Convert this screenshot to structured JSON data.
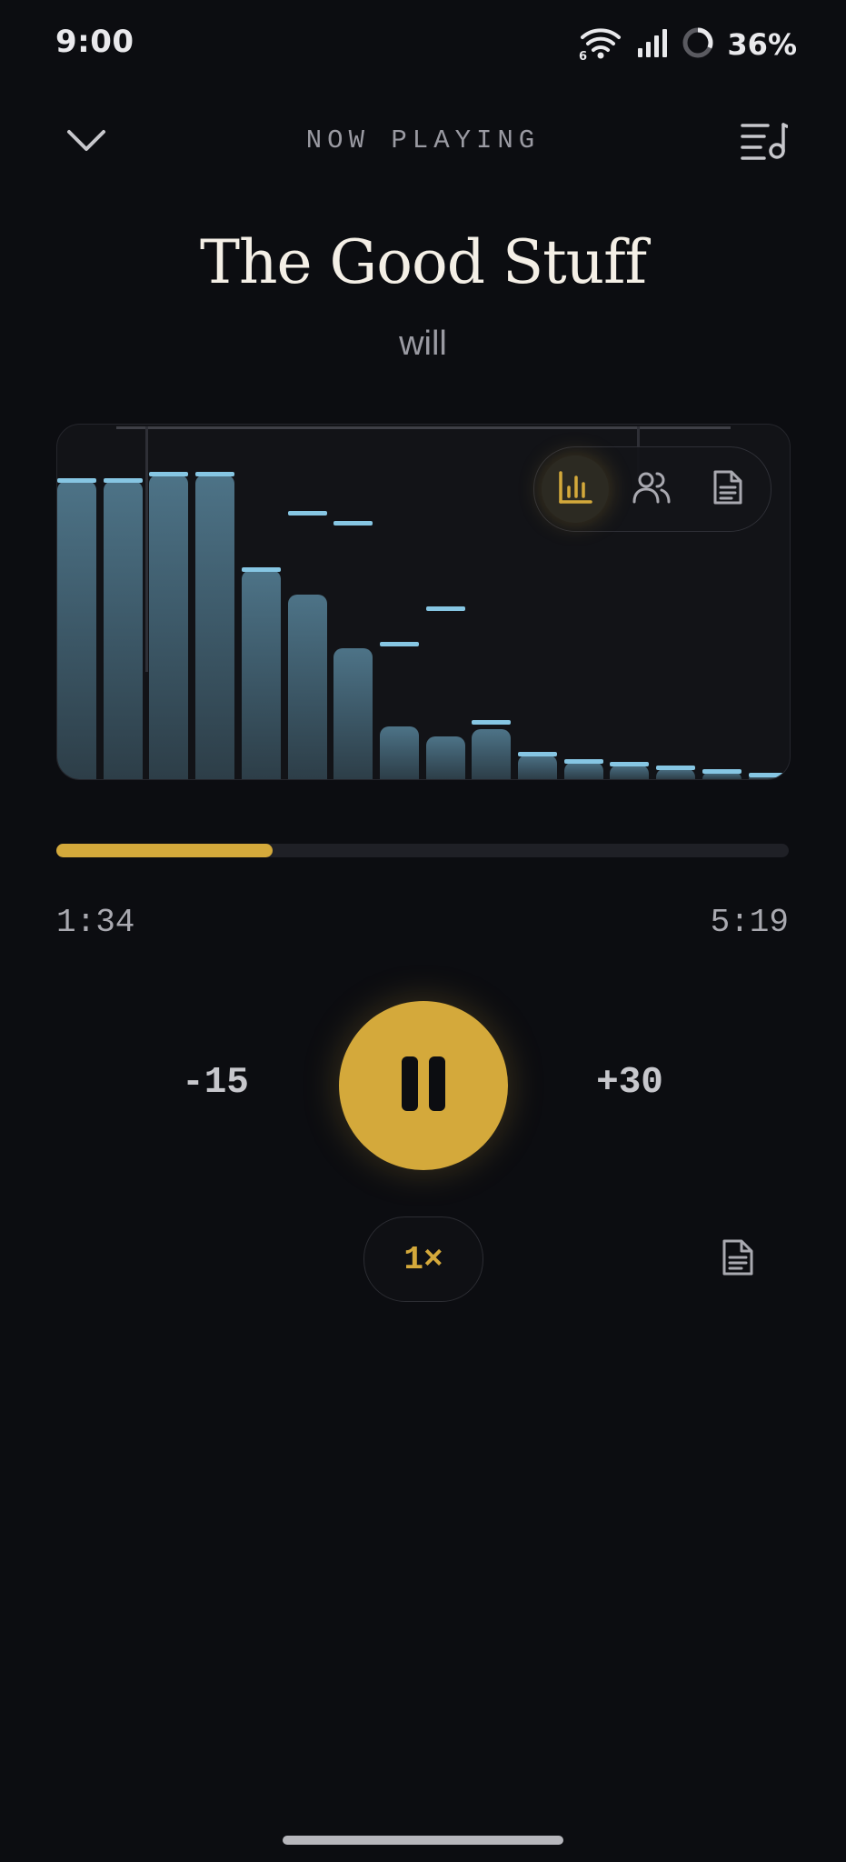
{
  "status_bar": {
    "time": "9:00",
    "wifi_badge": "6",
    "battery": "36%",
    "icons": [
      "wifi-icon",
      "signal-icon",
      "battery-ring-icon"
    ]
  },
  "header": {
    "title": "NOW PLAYING",
    "collapse_icon": "chevron-down-icon",
    "queue_icon": "playlist-music-icon"
  },
  "track": {
    "title": "The Good Stuff",
    "artist": "will"
  },
  "visualizer": {
    "modes": [
      {
        "name": "spectrum",
        "icon": "bar-chart-icon",
        "active": true
      },
      {
        "name": "people",
        "icon": "users-icon",
        "active": false
      },
      {
        "name": "transcript",
        "icon": "document-icon",
        "active": false
      }
    ],
    "levels": [
      0.84,
      0.84,
      0.86,
      0.86,
      0.59,
      0.52,
      0.37,
      0.15,
      0.12,
      0.14,
      0.07,
      0.05,
      0.04,
      0.03,
      0.02,
      0.01
    ],
    "peaks": [
      0.84,
      0.84,
      0.86,
      0.86,
      0.59,
      0.75,
      0.72,
      0.38,
      0.48,
      0.16,
      0.07,
      0.05,
      0.04,
      0.03,
      0.02,
      0.01
    ]
  },
  "progress": {
    "elapsed": "1:34",
    "total": "5:19",
    "fraction": 0.295
  },
  "controls": {
    "skip_back": "-15",
    "skip_forward": "+30",
    "play_state": "playing",
    "play_icon": "pause-icon",
    "speed": "1×",
    "transcript_icon": "document-icon"
  },
  "colors": {
    "background": "#0c0d11",
    "accent": "#d4a93b",
    "bar": "#4d7387",
    "peak": "#86c6e3",
    "muted_text": "#9a9aa2"
  }
}
